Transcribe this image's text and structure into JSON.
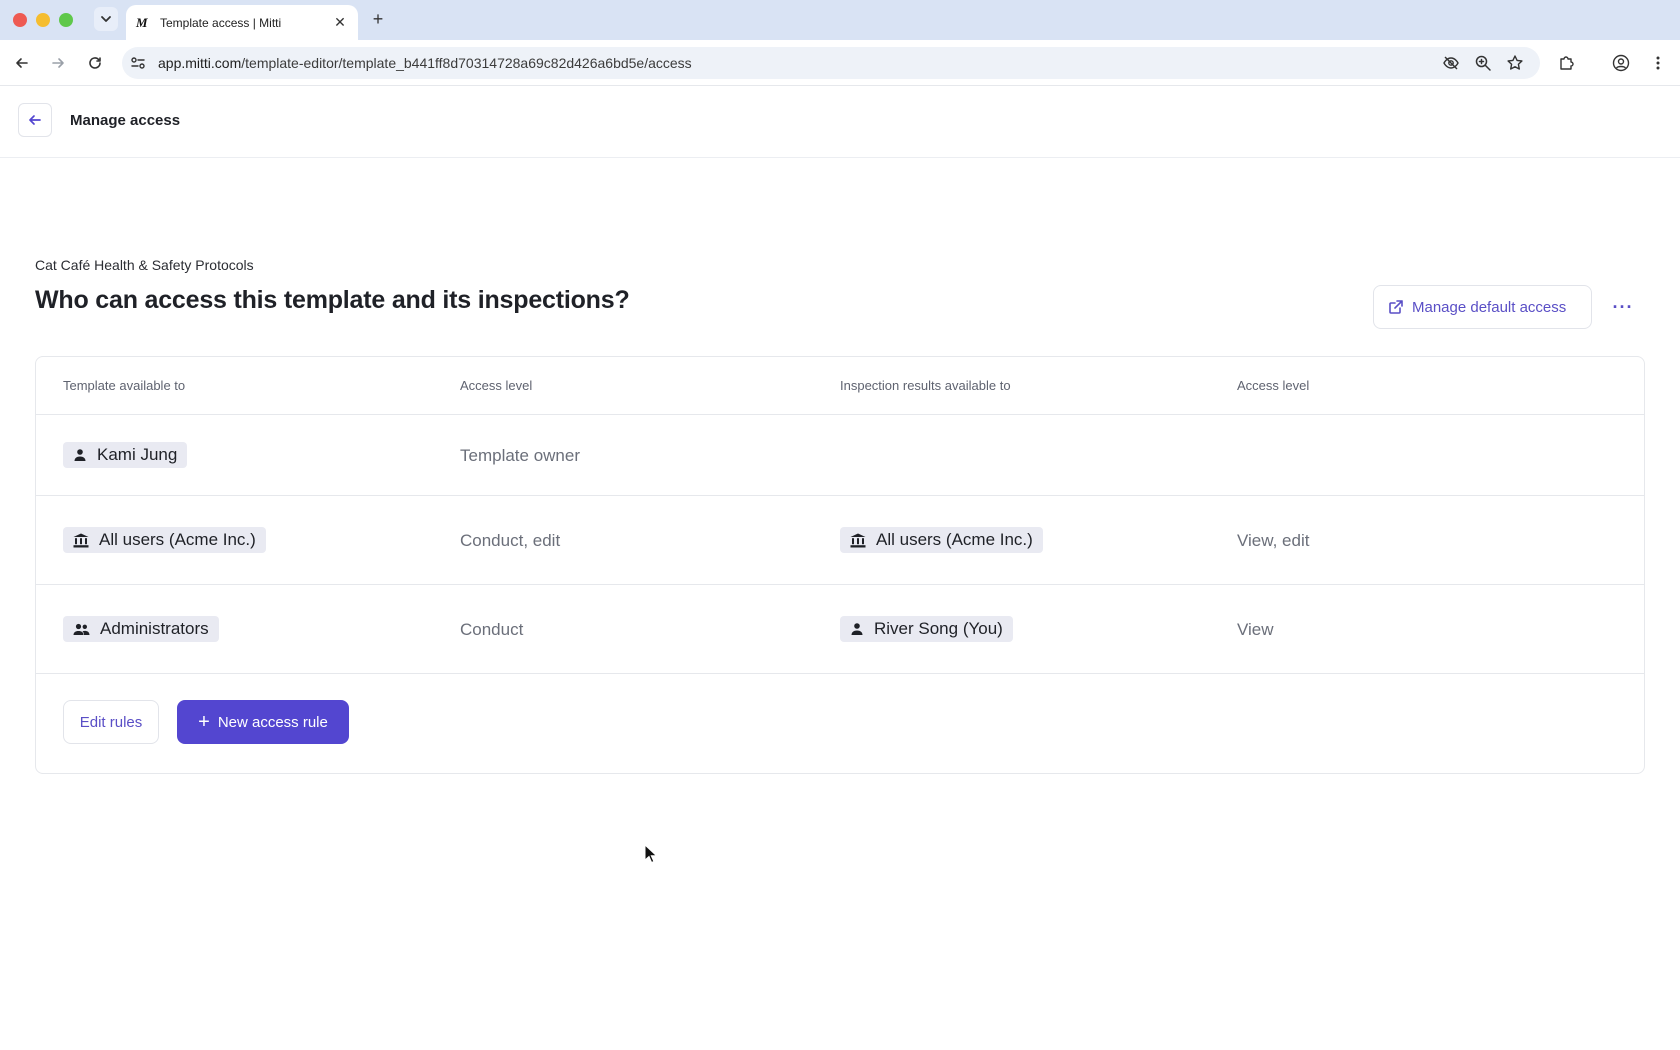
{
  "browser": {
    "tab_title": "Template access | Mitti",
    "tab_favicon": "M",
    "url_host": "app.mitti.com",
    "url_path": "/template-editor/template_b441ff8d70314728a69c82d426a6bd5e/access"
  },
  "header": {
    "title": "Manage access"
  },
  "page": {
    "subtitle": "Cat Café Health & Safety Protocols",
    "title": "Who can access this template and its inspections?",
    "manage_default_label": "Manage default access",
    "more_label": "···"
  },
  "table": {
    "columns": [
      "Template available to",
      "Access level",
      "Inspection results available to",
      "Access level"
    ],
    "rows": [
      {
        "template_to": "Kami Jung",
        "template_icon": "user-icon",
        "access_level": "Template owner",
        "results_to": "",
        "results_access": ""
      },
      {
        "template_to": "All users (Acme Inc.)",
        "template_icon": "organization-icon",
        "access_level": "Conduct, edit",
        "results_to": "All users (Acme Inc.)",
        "results_icon": "organization-icon",
        "results_access": "View, edit"
      },
      {
        "template_to": "Administrators",
        "template_icon": "group-icon",
        "access_level": "Conduct",
        "results_to": "River Song (You)",
        "results_icon": "user-icon",
        "results_access": "View"
      }
    ]
  },
  "actions": {
    "edit_rules": "Edit rules",
    "new_rule": "New access rule"
  },
  "colors": {
    "accent": "#5346d0",
    "chip_bg": "#e9eaf2",
    "tabbar_bg": "#d9e3f4"
  }
}
